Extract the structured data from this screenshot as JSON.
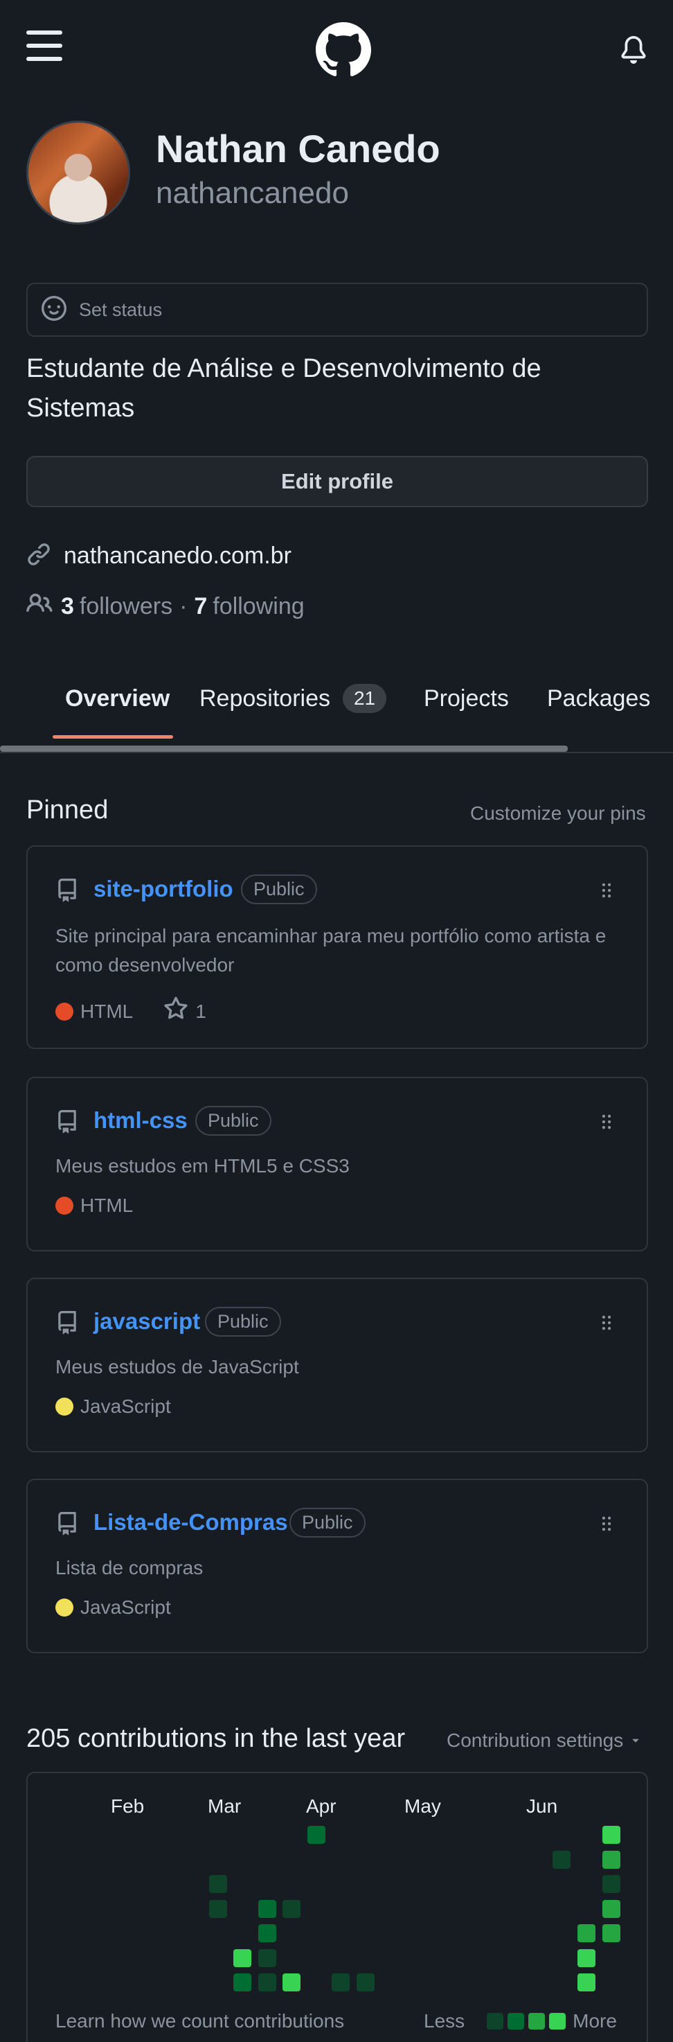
{
  "profile": {
    "name": "Nathan Canedo",
    "username": "nathancanedo",
    "status_placeholder": "Set status",
    "bio": "Estudante de Análise e Desenvolvimento de Sistemas",
    "edit_label": "Edit profile",
    "website": "nathancanedo.com.br",
    "followers_count": "3",
    "followers_label": "followers",
    "separator": "·",
    "following_count": "7",
    "following_label": "following"
  },
  "tabs": [
    {
      "label": "Overview",
      "active": true
    },
    {
      "label": "Repositories",
      "count": "21"
    },
    {
      "label": "Projects"
    },
    {
      "label": "Packages"
    }
  ],
  "pinned": {
    "title": "Pinned",
    "customize_label": "Customize your pins",
    "repos": [
      {
        "name": "site-portfolio",
        "visibility": "Public",
        "description": "Site principal para encaminhar para meu portfólio como artista e como desenvolvedor",
        "language": "HTML",
        "language_color": "#e34c26",
        "stars": "1"
      },
      {
        "name": "html-css",
        "visibility": "Public",
        "description": "Meus estudos em HTML5 e CSS3",
        "language": "HTML",
        "language_color": "#e34c26"
      },
      {
        "name": "javascript",
        "visibility": "Public",
        "description": "Meus estudos de JavaScript",
        "language": "JavaScript",
        "language_color": "#f1e05a"
      },
      {
        "name": "Lista-de-Compras",
        "visibility": "Public",
        "description": "Lista de compras",
        "language": "JavaScript",
        "language_color": "#f1e05a"
      }
    ]
  },
  "contributions": {
    "title": "205 contributions in the last year",
    "settings_label": "Contribution settings",
    "months": [
      "Feb",
      "Mar",
      "Apr",
      "May",
      "Jun"
    ],
    "learn_label": "Learn how we count contributions",
    "less_label": "Less",
    "more_label": "More",
    "level_colors": [
      "#0e4429",
      "#006d32",
      "#26a641",
      "#39d353"
    ]
  },
  "icons": {
    "menu": "hamburger-icon",
    "logo": "github-logo",
    "notifications": "bell-icon",
    "status": "smiley-icon",
    "link": "link-icon",
    "people": "people-icon",
    "repo": "repo-icon",
    "drag": "grabber-icon",
    "star": "star-icon",
    "caret": "caret-down-icon"
  }
}
